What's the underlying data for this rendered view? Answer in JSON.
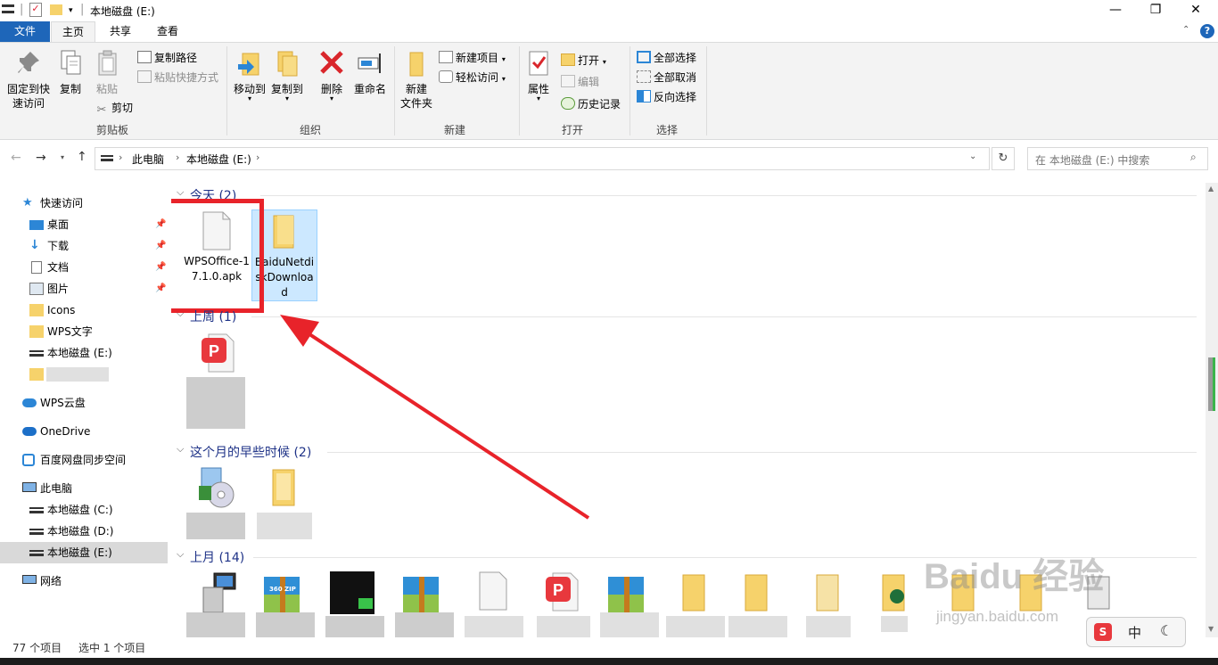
{
  "window": {
    "title": "本地磁盘 (E:)",
    "controls": {
      "minimize": "—",
      "maximize": "❐",
      "close": "✕"
    }
  },
  "ribbon_tabs": [
    {
      "label": "文件"
    },
    {
      "label": "主页"
    },
    {
      "label": "共享"
    },
    {
      "label": "查看"
    }
  ],
  "ribbon": {
    "clipboard": {
      "group_label": "剪贴板",
      "pin_quick_access": "固定到快\n速访问",
      "copy": "复制",
      "paste": "粘贴",
      "copy_path": "复制路径",
      "paste_shortcut": "粘贴快捷方式",
      "cut": "剪切"
    },
    "organize": {
      "group_label": "组织",
      "move_to": "移动到",
      "copy_to": "复制到",
      "delete": "删除",
      "rename": "重命名"
    },
    "new": {
      "group_label": "新建",
      "new_folder": "新建\n文件夹",
      "new_item": "新建项目",
      "easy_access": "轻松访问"
    },
    "open": {
      "group_label": "打开",
      "properties": "属性",
      "open": "打开",
      "edit": "编辑",
      "history": "历史记录"
    },
    "select": {
      "group_label": "选择",
      "select_all": "全部选择",
      "select_none": "全部取消",
      "invert": "反向选择"
    }
  },
  "address": {
    "breadcrumb": [
      "此电脑",
      "本地磁盘 (E:)"
    ],
    "search_placeholder": "在 本地磁盘 (E:) 中搜索"
  },
  "nav": {
    "quick_access": "快速访问",
    "items": [
      {
        "label": "桌面"
      },
      {
        "label": "下载"
      },
      {
        "label": "文档"
      },
      {
        "label": "图片"
      },
      {
        "label": "Icons"
      },
      {
        "label": "WPS文字"
      },
      {
        "label": "本地磁盘 (E:)"
      }
    ],
    "wps_cloud": "WPS云盘",
    "onedrive": "OneDrive",
    "baidu_sync": "百度网盘同步空间",
    "this_pc": "此电脑",
    "drives": [
      {
        "label": "本地磁盘 (C:)"
      },
      {
        "label": "本地磁盘 (D:)"
      },
      {
        "label": "本地磁盘 (E:)"
      }
    ],
    "network": "网络"
  },
  "groups": [
    {
      "title": "今天 (2)"
    },
    {
      "title": "上周 (1)"
    },
    {
      "title": "这个月的早些时候 (2)"
    },
    {
      "title": "上月 (14)"
    }
  ],
  "files": {
    "today_1": "WPSOffice-17.1.0.apk",
    "today_2": "BaiduNetdiskDownload",
    "zip_badge": "360 ZIP"
  },
  "status": {
    "count": "77 个项目",
    "selected": "选中 1 个项目"
  },
  "watermark": {
    "brand": "Baidu 经验",
    "url": "jingyan.baidu.com"
  },
  "ime": {
    "mode": "中"
  },
  "colors": {
    "accent": "#1e66b9",
    "highlight_box": "#e8232a",
    "selection": "#cce8ff"
  }
}
